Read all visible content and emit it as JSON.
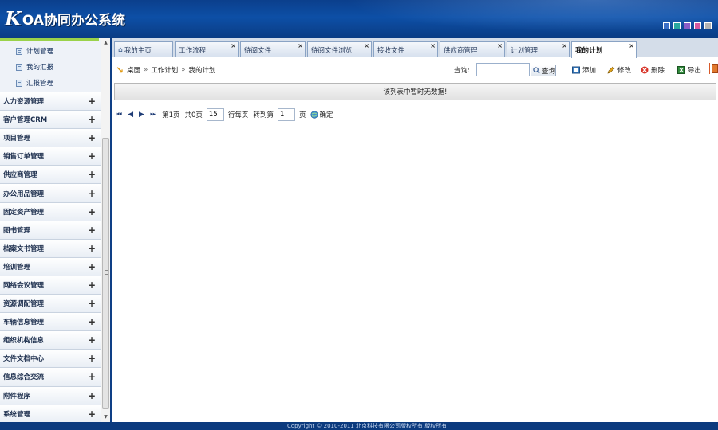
{
  "app": {
    "logo_k": "K",
    "title": "OA协同办公系统",
    "theme_colors": [
      "#3b6fc6",
      "#2aa8a0",
      "#8a5cc8",
      "#d45aa0",
      "#b3b3b3"
    ]
  },
  "sidebar": {
    "sub_items": [
      {
        "label": "计划管理"
      },
      {
        "label": "我的汇报"
      },
      {
        "label": "汇报管理"
      }
    ],
    "menu": [
      {
        "label": "人力资源管理"
      },
      {
        "label": "客户管理CRM"
      },
      {
        "label": "项目管理"
      },
      {
        "label": "销售订单管理"
      },
      {
        "label": "供应商管理"
      },
      {
        "label": "办公用品管理"
      },
      {
        "label": "固定资产管理"
      },
      {
        "label": "图书管理"
      },
      {
        "label": "档案文书管理"
      },
      {
        "label": "培训管理"
      },
      {
        "label": "网络会议管理"
      },
      {
        "label": "资源调配管理"
      },
      {
        "label": "车辆信息管理"
      },
      {
        "label": "组织机构信息"
      },
      {
        "label": "文件文档中心"
      },
      {
        "label": "信息综合交流"
      },
      {
        "label": "附件程序"
      },
      {
        "label": "系统管理"
      }
    ],
    "expand_symbol": "+"
  },
  "tabs": [
    {
      "label": "我的主页"
    },
    {
      "label": "工作流程"
    },
    {
      "label": "待阅文件"
    },
    {
      "label": "待阅文件浏览"
    },
    {
      "label": "接收文件"
    },
    {
      "label": "供应商管理"
    },
    {
      "label": "计划管理"
    },
    {
      "label": "我的计划"
    }
  ],
  "tab_close": "×",
  "breadcrumb": {
    "items": [
      "桌面",
      "工作计划",
      "我的计划"
    ],
    "separator": "»"
  },
  "search": {
    "label": "查询:",
    "value": "",
    "button_label": "查询"
  },
  "toolbar": {
    "add_label": "添加",
    "edit_label": "修改",
    "delete_label": "删除",
    "export_label": "导出"
  },
  "notice": "该列表中暂时无数据!",
  "pager": {
    "page_label": "第1页",
    "total_label": "共0页",
    "per_page_value": "15",
    "per_page_label": "行每页",
    "goto_label": "转到第",
    "goto_value": "1",
    "page_unit": "页",
    "confirm_label": "确定"
  },
  "footer": {
    "copyright": "Copyright © 2010-2011 北京科技有限公司版权所有 版权所有"
  }
}
